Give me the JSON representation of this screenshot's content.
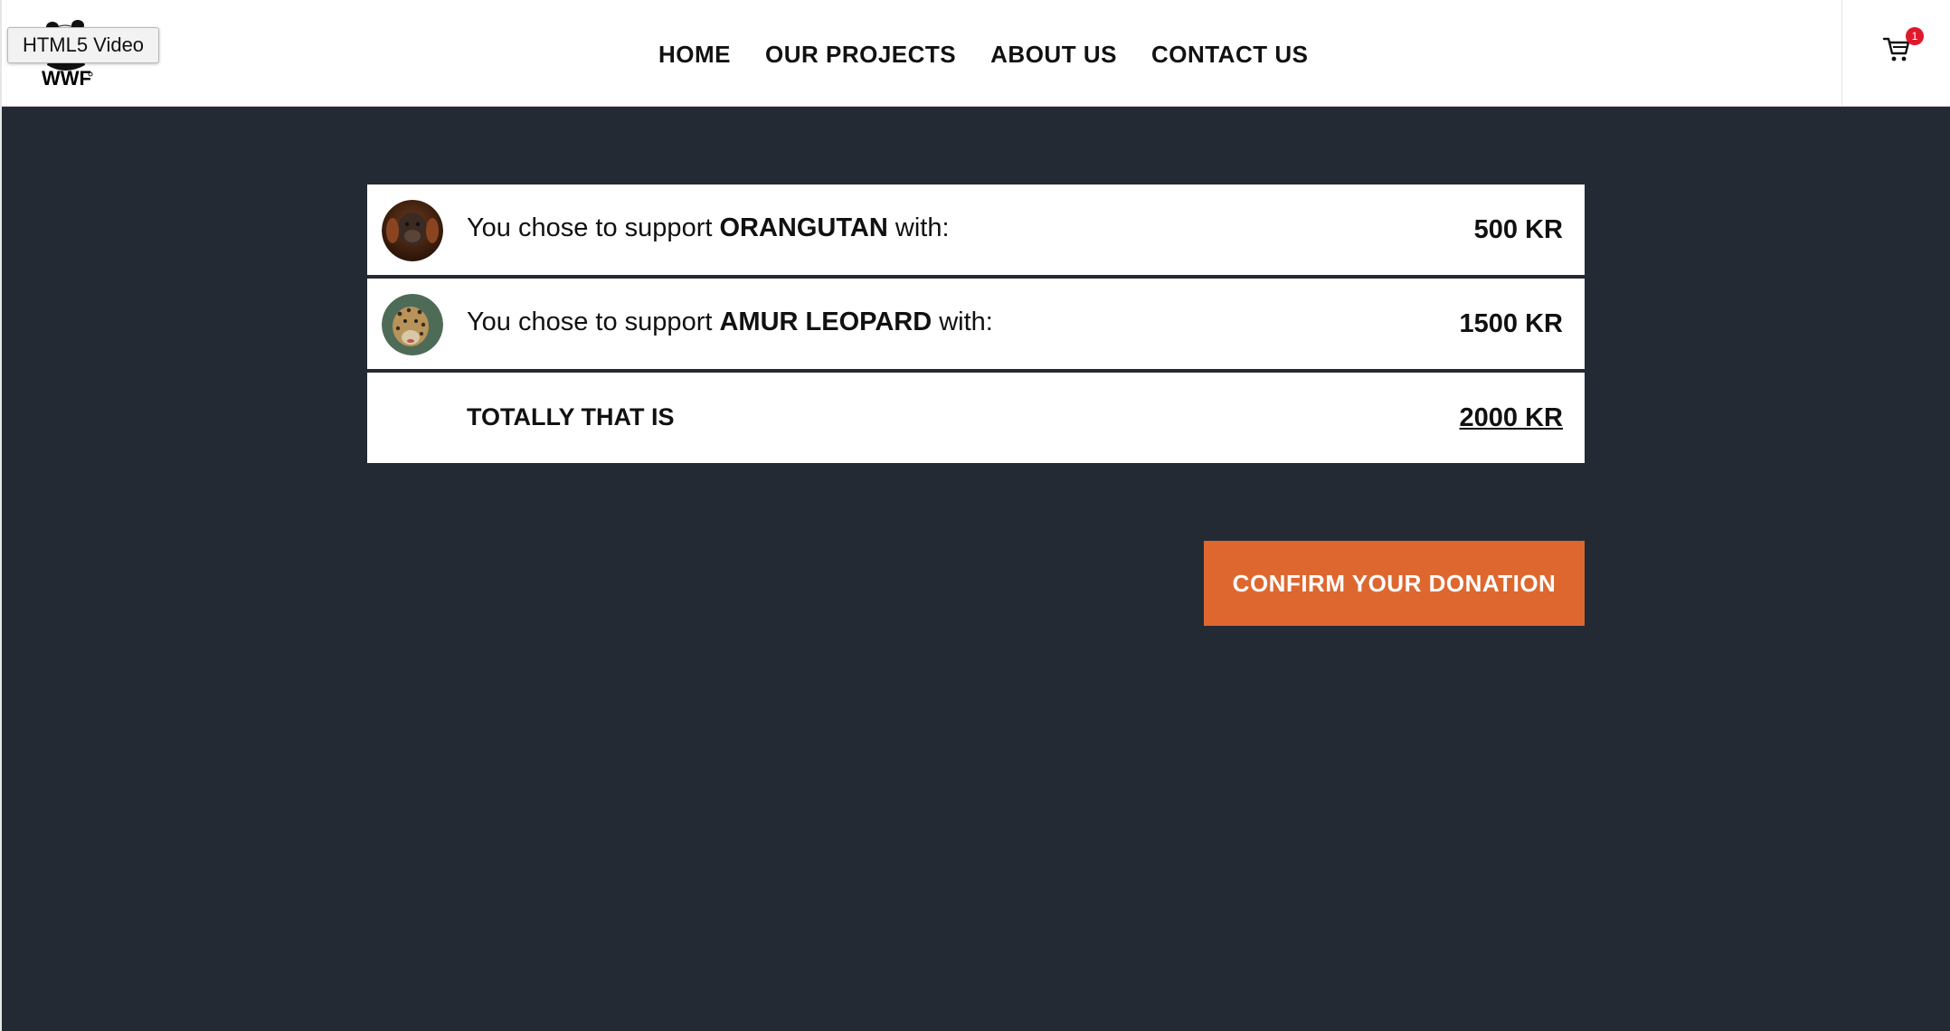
{
  "tooltip": "HTML5 Video",
  "logo": {
    "text": "WWF"
  },
  "nav": {
    "items": [
      "HOME",
      "OUR PROJECTS",
      "ABOUT US",
      "CONTACT US"
    ]
  },
  "cart": {
    "icon": "cart-icon",
    "badge_count": "1",
    "badge_color": "#e0182d"
  },
  "summary": {
    "rows": [
      {
        "prefix": "You chose to support ",
        "animal": "ORANGUTAN",
        "suffix": " with:",
        "amount": "500 KR",
        "avatar_icon": "orangutan-avatar"
      },
      {
        "prefix": "You chose to support ",
        "animal": "AMUR LEOPARD",
        "suffix": " with:",
        "amount": "1500 KR",
        "avatar_icon": "leopard-avatar"
      }
    ],
    "total_label": "TOTALLY THAT IS",
    "total_amount": "2000 KR"
  },
  "confirm_button": {
    "label": "CONFIRM YOUR DONATION",
    "color": "#de6730"
  },
  "colors": {
    "background": "#232a34",
    "header": "#ffffff"
  }
}
